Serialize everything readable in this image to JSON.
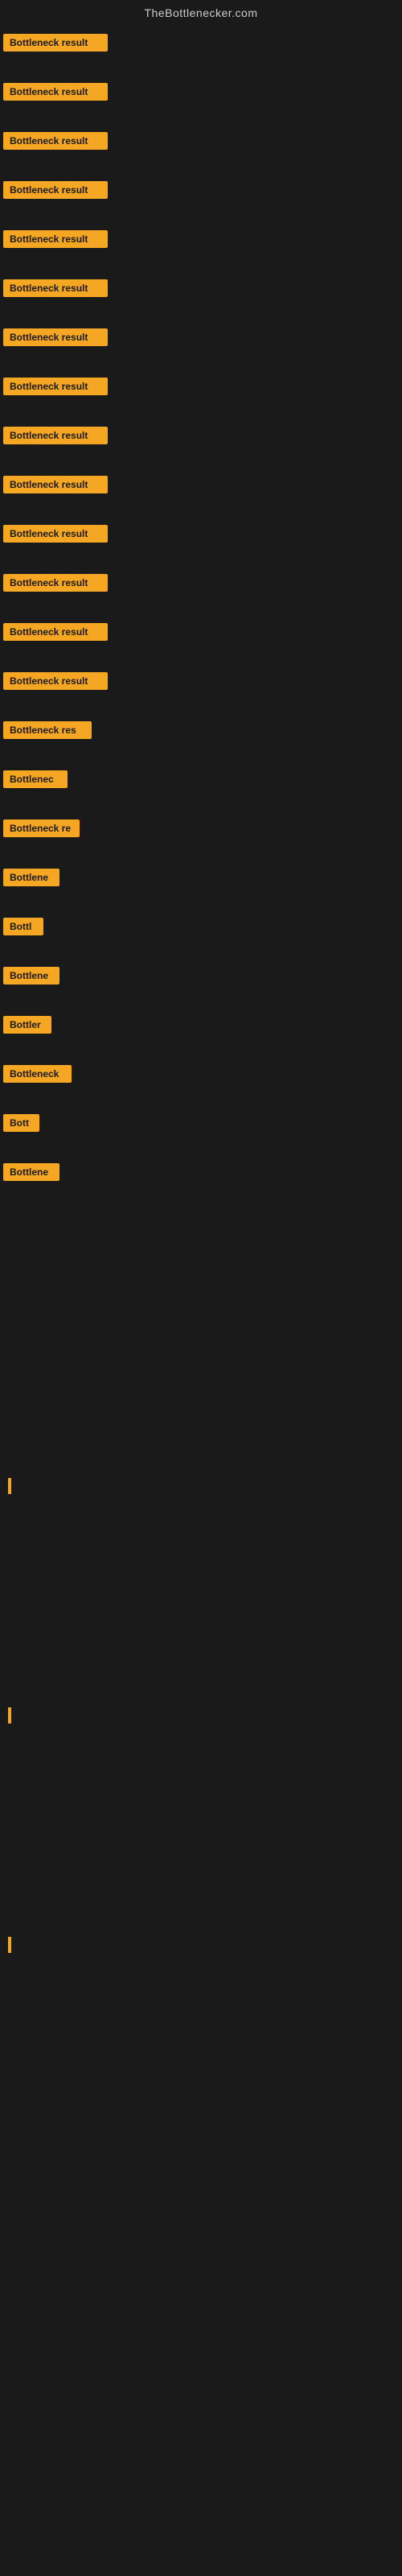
{
  "site": {
    "title": "TheBottlenecker.com"
  },
  "rows": [
    {
      "id": 1,
      "label": "Bottleneck result"
    },
    {
      "id": 2,
      "label": "Bottleneck result"
    },
    {
      "id": 3,
      "label": "Bottleneck result"
    },
    {
      "id": 4,
      "label": "Bottleneck result"
    },
    {
      "id": 5,
      "label": "Bottleneck result"
    },
    {
      "id": 6,
      "label": "Bottleneck result"
    },
    {
      "id": 7,
      "label": "Bottleneck result"
    },
    {
      "id": 8,
      "label": "Bottleneck result"
    },
    {
      "id": 9,
      "label": "Bottleneck result"
    },
    {
      "id": 10,
      "label": "Bottleneck result"
    },
    {
      "id": 11,
      "label": "Bottleneck result"
    },
    {
      "id": 12,
      "label": "Bottleneck result"
    },
    {
      "id": 13,
      "label": "Bottleneck result"
    },
    {
      "id": 14,
      "label": "Bottleneck result"
    },
    {
      "id": 15,
      "label": "Bottleneck res"
    },
    {
      "id": 16,
      "label": "Bottlenec"
    },
    {
      "id": 17,
      "label": "Bottleneck re"
    },
    {
      "id": 18,
      "label": "Bottlene"
    },
    {
      "id": 19,
      "label": "Bottl"
    },
    {
      "id": 20,
      "label": "Bottlene"
    },
    {
      "id": 21,
      "label": "Bottler"
    },
    {
      "id": 22,
      "label": "Bottleneck"
    },
    {
      "id": 23,
      "label": "Bott"
    },
    {
      "id": 24,
      "label": "Bottlene"
    }
  ],
  "bottom_items": [
    {
      "id": 1
    },
    {
      "id": 2
    },
    {
      "id": 3
    }
  ]
}
